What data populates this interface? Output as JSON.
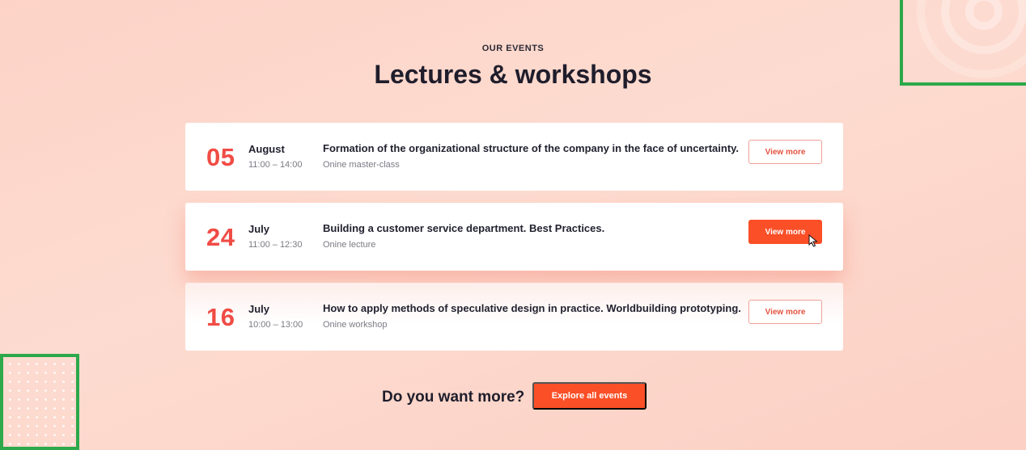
{
  "header": {
    "eyebrow": "OUR EVENTS",
    "title": "Lectures & workshops"
  },
  "events": [
    {
      "day": "05",
      "month": "August",
      "time": "11:00 – 14:00",
      "title": "Formation of the organizational structure of the company in the face of uncertainty.",
      "type": "Onine master-class",
      "button": "View more"
    },
    {
      "day": "24",
      "month": "July",
      "time": "11:00 – 12:30",
      "title": "Building a customer service department. Best Practices.",
      "type": "Onine lecture",
      "button": "View more"
    },
    {
      "day": "16",
      "month": "July",
      "time": "10:00 – 13:00",
      "title": "How to apply methods of speculative design in practice. Worldbuilding prototyping.",
      "type": "Onine workshop",
      "button": "View more"
    }
  ],
  "footer": {
    "question": "Do you want more?",
    "explore_label": "Explore all events"
  },
  "colors": {
    "accent": "#fa4f27",
    "date": "#f04c45",
    "background": "#fdd3c7",
    "highlight_frame": "#2da84a"
  },
  "icons": {
    "cursor": "pointer-cursor-icon"
  }
}
